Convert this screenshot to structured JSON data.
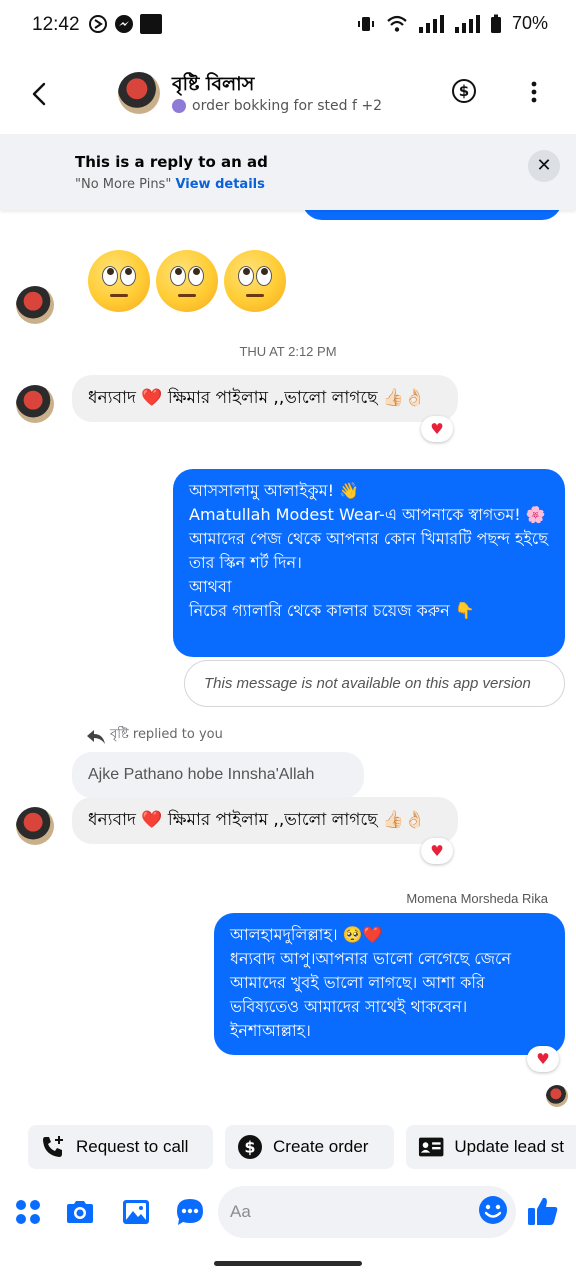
{
  "status_bar": {
    "time": "12:42",
    "battery": "70%"
  },
  "header": {
    "name": "বৃষ্টি বিলাস",
    "subtitle": "order bokking for sted f +2",
    "icons": [
      "back-arrow-icon",
      "dollar-icon",
      "more-vertical-icon"
    ]
  },
  "banner": {
    "title": "This is a reply to an ad",
    "ad_name": "\"No More Pins\"",
    "link": "View details",
    "close_symbol": "✕"
  },
  "messages": {
    "emojis": [
      "🙄",
      "🙄",
      "🙄"
    ],
    "timestamp": "THU AT 2:12 PM",
    "incoming_1": "ধন্যবাদ ❤️ ক্ষিমার পাইলাম ,,ভালো লাগছে 👍🏻👌🏻",
    "outgoing_1": "আসসালামু আলাইকুম! 👋\nAmatullah Modest Wear-এ আপনাকে স্বাগতম! 🌸\nআমাদের পেজ থেকে আপনার কোন খিমারটি পছন্দ হইছে তার স্কিন শর্ট দিন।\nআথবা\nনিচের গ্যালারি থেকে কালার চয়েজ করুন 👇",
    "unavailable_notice": "This message is not available on this app version",
    "replied_label": "বৃষ্টি replied to you",
    "quoted_text": "Ajke Pathano hobe Innsha'Allah",
    "incoming_2": "ধন্যবাদ ❤️ ক্ষিমার পাইলাম ,,ভালো লাগছে 👍🏻👌🏻",
    "sender_name": "Momena Morsheda Rika",
    "outgoing_2": "আলহামদুলিল্লাহ। 🥺❤️\nধন্যবাদ আপু।আপনার ভালো লেগেছে জেনে আমাদের খুবই ভালো লাগছে। আশা করি ভবিষ্যতেও আমাদের সাথেই থাকবেন। ইনশাআল্লাহ।",
    "reaction": "♥"
  },
  "quick_actions": {
    "request_call": "Request to call",
    "create_order": "Create order",
    "update_lead": "Update lead st"
  },
  "composer": {
    "placeholder": "Aa"
  },
  "colors": {
    "accent": "#0a6cff",
    "incoming_bubble": "#f0f0f0",
    "reaction_heart": "#e8213b"
  }
}
